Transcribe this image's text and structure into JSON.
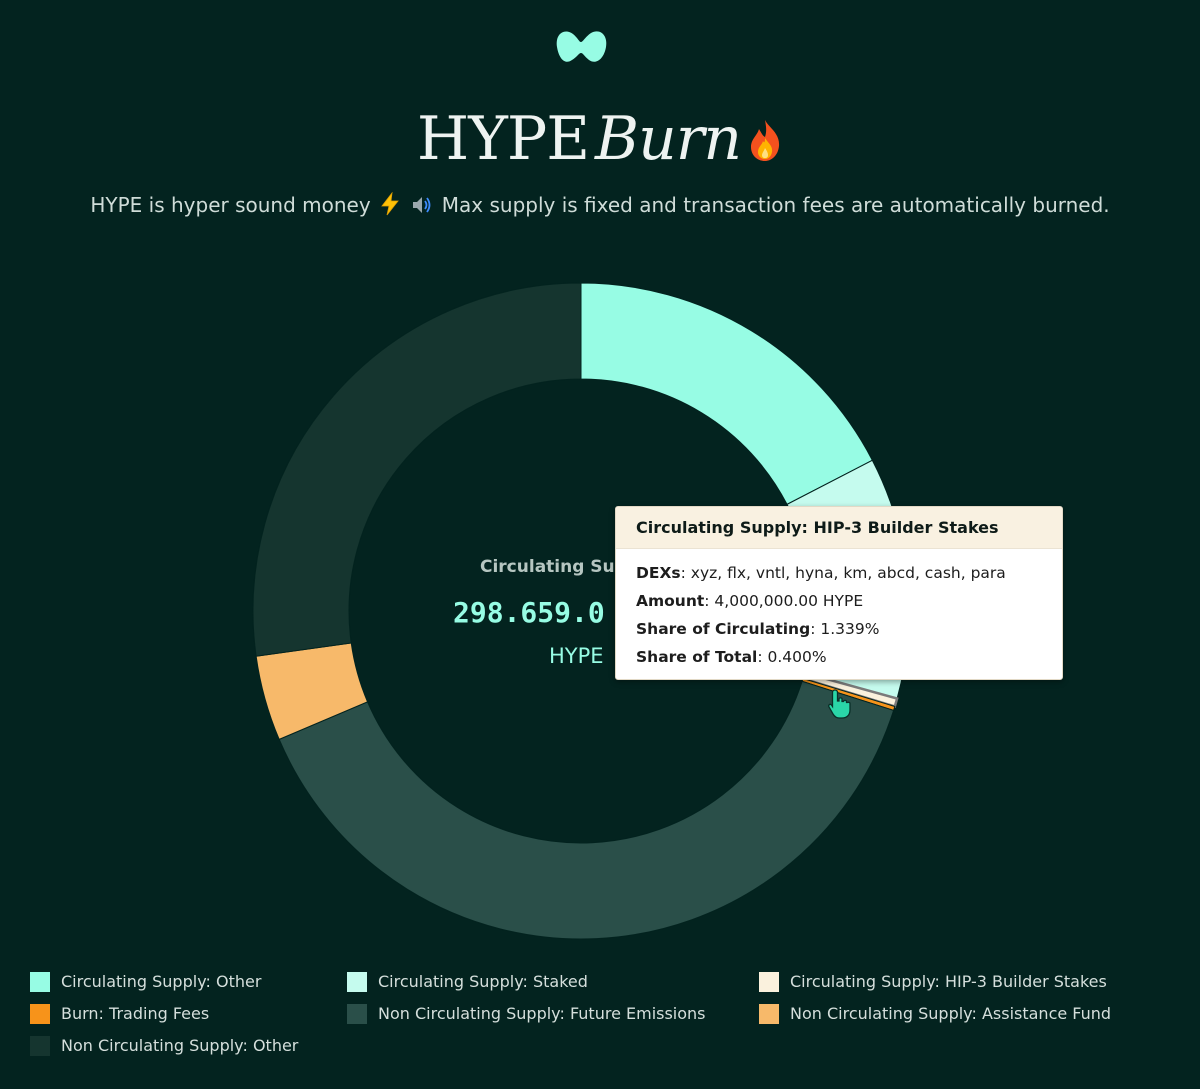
{
  "header": {
    "logo_icon": "hyperliquid-logo-icon",
    "title_main": "HYPE",
    "title_accent": "Burn",
    "title_emoji_icon": "fire-icon",
    "subtitle_text_1": "HYPE is hyper sound money",
    "subtitle_emoji_1": "lightning-icon",
    "subtitle_emoji_2": "speaker-icon",
    "subtitle_text_2": "Max supply is fixed and transaction fees are automatically burned."
  },
  "chart_data": {
    "type": "pie",
    "categories": [
      "Circulating Supply: Other",
      "Circulating Supply: Staked",
      "Circulating Supply: HIP-3 Builder Stakes",
      "Burn: Trading Fees",
      "Non Circulating Supply: Future Emissions",
      "Non Circulating Supply: Assistance Fund",
      "Non Circulating Supply: Other"
    ],
    "values_percent_of_total": [
      17.4,
      11.9,
      0.4,
      0.2,
      38.7,
      4.2,
      27.2
    ],
    "colors": [
      "#97fce4",
      "#c5fbee",
      "#faf1dd",
      "#f7931a",
      "#2a4f49",
      "#f7b96a",
      "#15352f"
    ],
    "hovered": "Circulating Supply: HIP-3 Builder Stakes"
  },
  "center": {
    "label": "Circulating Supply",
    "value": "298.659.0",
    "unit": "HYPE"
  },
  "tooltip": {
    "title": "Circulating Supply: HIP-3 Builder Stakes",
    "rows": [
      {
        "label": "DEXs",
        "value": ": xyz, flx, vntl, hyna, km, abcd, cash, para"
      },
      {
        "label": "Amount",
        "value": ": 4,000,000.00 HYPE"
      },
      {
        "label": "Share of Circulating",
        "value": ": 1.339%"
      },
      {
        "label": "Share of Total",
        "value": ": 0.400%"
      }
    ]
  },
  "legend": {
    "items": [
      {
        "label": "Circulating Supply: Other",
        "color": "#97fce4"
      },
      {
        "label": "Circulating Supply: Staked",
        "color": "#c5fbee"
      },
      {
        "label": "Circulating Supply: HIP-3 Builder Stakes",
        "color": "#faf1dd"
      },
      {
        "label": "Burn: Trading Fees",
        "color": "#f7931a"
      },
      {
        "label": "Non Circulating Supply: Future Emissions",
        "color": "#2a4f49"
      },
      {
        "label": "Non Circulating Supply: Assistance Fund",
        "color": "#f7b96a"
      },
      {
        "label": "Non Circulating Supply: Other",
        "color": "#15352f"
      }
    ]
  },
  "colors": {
    "background": "#03231f",
    "accent": "#97fce4"
  }
}
